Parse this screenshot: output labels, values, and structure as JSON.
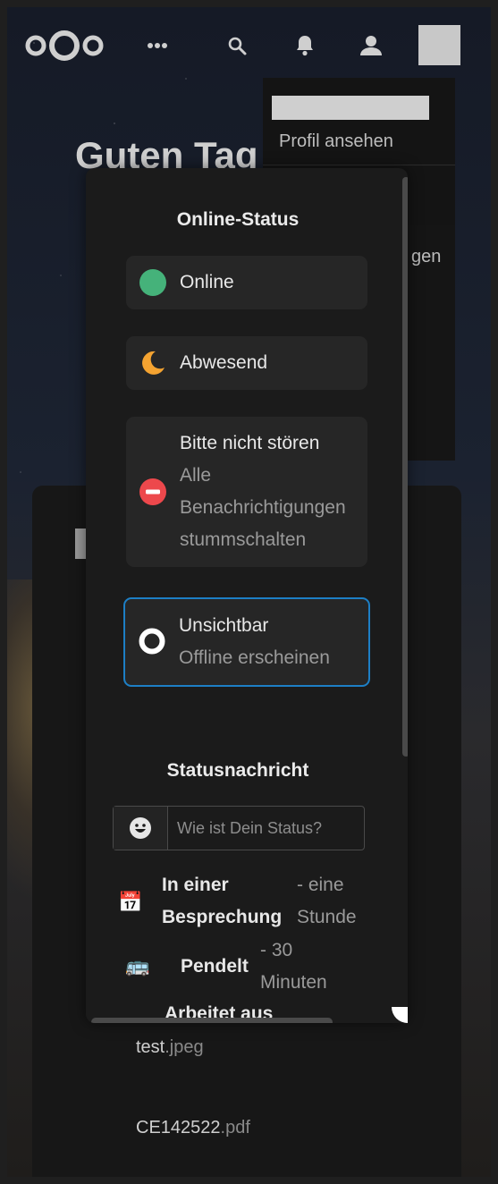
{
  "header": {
    "logo_name": "nextcloud-logo",
    "icons": [
      "apps-menu-icon",
      "search-icon",
      "bell-icon",
      "contacts-icon"
    ]
  },
  "dashboard": {
    "greeting": "Guten Tag"
  },
  "user_menu": {
    "view_profile": "Profil ansehen",
    "partial_item": "gen"
  },
  "status_modal": {
    "title": "Online-Status",
    "options": [
      {
        "label": "Online",
        "sublabel": "",
        "icon": "online-dot-icon",
        "color": "#45b27a",
        "selected": false
      },
      {
        "label": "Abwesend",
        "sublabel": "",
        "icon": "moon-icon",
        "color": "#f4a331",
        "selected": false
      },
      {
        "label": "Bitte nicht stören",
        "sublabel": "Alle Benachrichtigungen stummschalten",
        "icon": "do-not-disturb-icon",
        "color": "#ed484c",
        "selected": false
      },
      {
        "label": "Unsichtbar",
        "sublabel": "Offline erscheinen",
        "icon": "invisible-ring-icon",
        "color": "#ffffff",
        "selected": true
      }
    ],
    "message_title": "Statusnachricht",
    "message_placeholder": "Wie ist Dein Status?",
    "presets": [
      {
        "emoji": "📅",
        "label": "In einer Besprechung",
        "time": "- eine Stunde"
      },
      {
        "emoji": "🚌",
        "label": "Pendelt",
        "time": "- 30 Minuten"
      },
      {
        "emoji": "",
        "label": "Arbeitet aus",
        "time": ""
      }
    ]
  },
  "files": [
    {
      "name": "test",
      "ext": ".jpeg"
    },
    {
      "name": "CE142522",
      "ext": ".pdf"
    }
  ],
  "colors": {
    "accent": "#1d7fc5",
    "online": "#45b27a",
    "away": "#f4a331",
    "dnd": "#ed484c"
  }
}
